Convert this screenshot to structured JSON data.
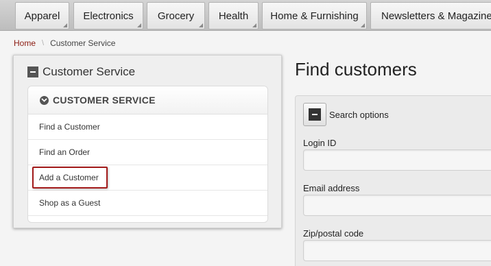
{
  "nav": {
    "tabs": [
      {
        "label": "Apparel"
      },
      {
        "label": "Electronics"
      },
      {
        "label": "Grocery"
      },
      {
        "label": "Health"
      },
      {
        "label": "Home & Furnishing"
      },
      {
        "label": "Newsletters & Magazines"
      }
    ]
  },
  "breadcrumb": {
    "home": "Home",
    "separator": "\\",
    "current": "Customer Service"
  },
  "panel": {
    "title": "Customer Service",
    "menu_title": "CUSTOMER SERVICE",
    "items": [
      {
        "label": "Find a Customer"
      },
      {
        "label": "Find an Order"
      },
      {
        "label": "Add a Customer",
        "highlighted": true
      },
      {
        "label": "Shop as a Guest"
      }
    ]
  },
  "main": {
    "title": "Find customers",
    "search": {
      "toggle_label": "Search options",
      "fields": [
        {
          "label": "Login ID",
          "value": ""
        },
        {
          "label": "Email address",
          "value": ""
        },
        {
          "label": "Zip/postal code",
          "value": ""
        }
      ]
    }
  },
  "colors": {
    "breadcrumb_link": "#8b1a10",
    "highlight_border": "#a21a1a"
  }
}
